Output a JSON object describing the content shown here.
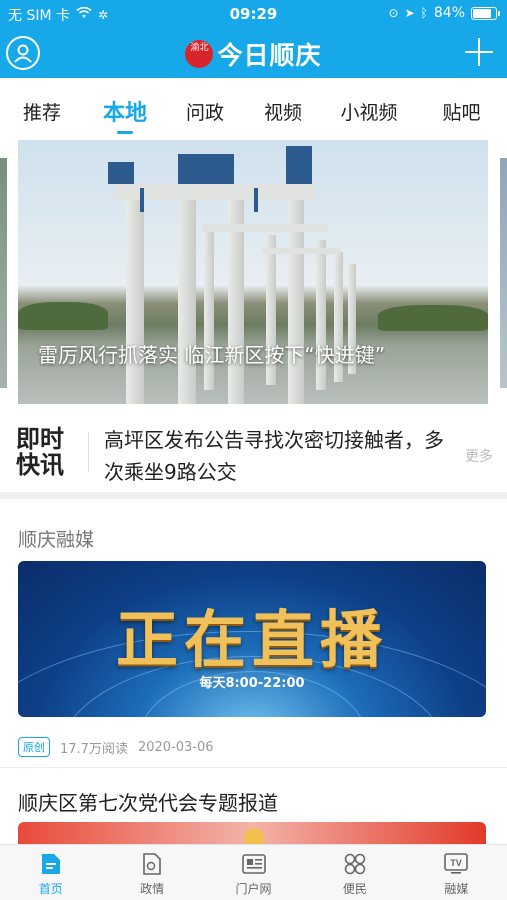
{
  "status_bar": {
    "carrier": "无 SIM 卡",
    "time": "09:29",
    "battery": "84%",
    "battery_level": 0.84
  },
  "header": {
    "seal_text": "渝北",
    "app_name": "今日顺庆"
  },
  "tabs": [
    {
      "label": "推荐",
      "active": false
    },
    {
      "label": "本地",
      "active": true
    },
    {
      "label": "问政",
      "active": false
    },
    {
      "label": "视频",
      "active": false
    },
    {
      "label": "小视频",
      "active": false
    },
    {
      "label": "贴吧",
      "active": false
    }
  ],
  "hero": {
    "caption": "雷厉风行抓落实  临江新区按下“快进键”"
  },
  "flash": {
    "logo_line1": "即时",
    "logo_line2": "快讯",
    "headline": "高坪区发布公告寻找次密切接触者，多次乘坐9路公交",
    "more": "更多"
  },
  "section": {
    "title": "顺庆融媒",
    "banner_main": "正在直播",
    "banner_sub": "每天8:00-22:00",
    "tag": "原创",
    "reads": "17.7万阅读",
    "date": "2020-03-06"
  },
  "topic": {
    "title": "顺庆区第七次党代会专题报道"
  },
  "bottom_nav": [
    {
      "label": "首页",
      "icon": "home-icon",
      "active": true
    },
    {
      "label": "政情",
      "icon": "document-icon",
      "active": false
    },
    {
      "label": "门户网",
      "icon": "news-icon",
      "active": false
    },
    {
      "label": "便民",
      "icon": "grid-icon",
      "active": false
    },
    {
      "label": "融媒",
      "icon": "tv-icon",
      "active": false
    }
  ],
  "colors": {
    "brand": "#16a8e8",
    "seal": "#d8242a"
  }
}
